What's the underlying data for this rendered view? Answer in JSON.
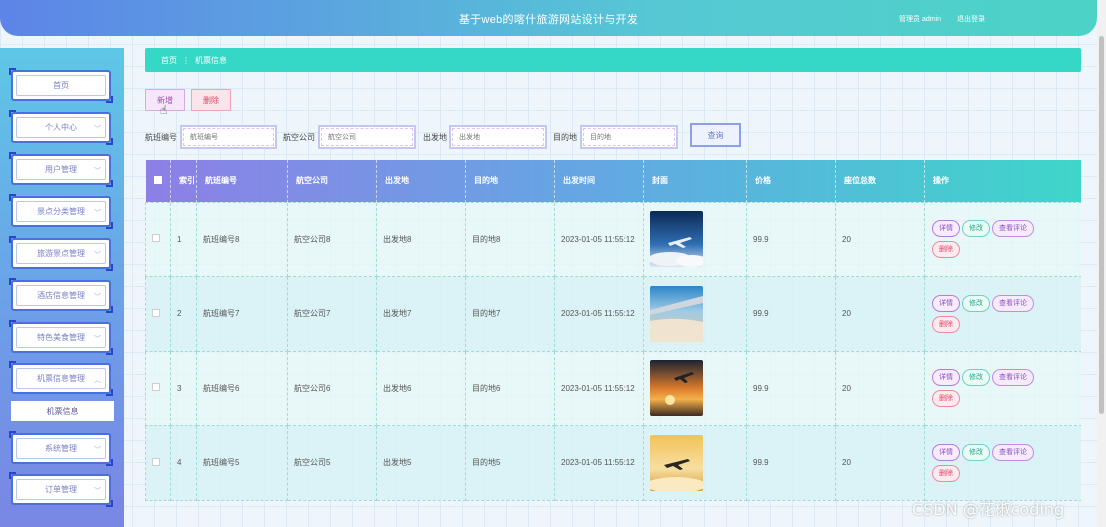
{
  "header": {
    "title": "基于web的喀什旅游网站设计与开发",
    "user": "管理员 admin",
    "logout": "退出登录"
  },
  "sidebar": {
    "items": [
      {
        "label": "首页",
        "chevron": false
      },
      {
        "label": "个人中心",
        "chevron": true
      },
      {
        "label": "用户管理",
        "chevron": true
      },
      {
        "label": "景点分类管理",
        "chevron": true
      },
      {
        "label": "旅游景点管理",
        "chevron": true
      },
      {
        "label": "酒店信息管理",
        "chevron": true
      },
      {
        "label": "特色美食管理",
        "chevron": true
      },
      {
        "label": "机票信息管理",
        "chevron": true,
        "expanded": true
      },
      {
        "label": "系统管理",
        "chevron": true
      },
      {
        "label": "订单管理",
        "chevron": true
      }
    ],
    "submenu": "机票信息"
  },
  "breadcrumb": {
    "home": "首页",
    "sep": "⋮",
    "current": "机票信息"
  },
  "actions": {
    "add": "新增",
    "delete": "删除"
  },
  "search": {
    "flight_label": "航班编号",
    "flight_placeholder": "航班编号",
    "airline_label": "航空公司",
    "airline_placeholder": "航空公司",
    "origin_label": "出发地",
    "origin_placeholder": "出发地",
    "dest_label": "目的地",
    "dest_placeholder": "目的地",
    "button": "查询"
  },
  "table": {
    "columns": [
      "索引",
      "航班编号",
      "航空公司",
      "出发地",
      "目的地",
      "出发时间",
      "封面",
      "价格",
      "座位总数",
      "操作"
    ],
    "rows": [
      {
        "index": "1",
        "flight": "航班编号8",
        "airline": "航空公司8",
        "origin": "出发地8",
        "dest": "目的地8",
        "time": "2023-01-05 11:55:12",
        "price": "99.9",
        "seats": "20"
      },
      {
        "index": "2",
        "flight": "航班编号7",
        "airline": "航空公司7",
        "origin": "出发地7",
        "dest": "目的地7",
        "time": "2023-01-05 11:55:12",
        "price": "99.9",
        "seats": "20"
      },
      {
        "index": "3",
        "flight": "航班编号6",
        "airline": "航空公司6",
        "origin": "出发地6",
        "dest": "目的地6",
        "time": "2023-01-05 11:55:12",
        "price": "99.9",
        "seats": "20"
      },
      {
        "index": "4",
        "flight": "航班编号5",
        "airline": "航空公司5",
        "origin": "出发地5",
        "dest": "目的地5",
        "time": "2023-01-05 11:55:12",
        "price": "99.9",
        "seats": "20"
      }
    ],
    "ops": {
      "detail": "详情",
      "edit": "修改",
      "review": "查看评论",
      "delete": "删除"
    }
  },
  "watermark": "CSDN @花椒coding"
}
